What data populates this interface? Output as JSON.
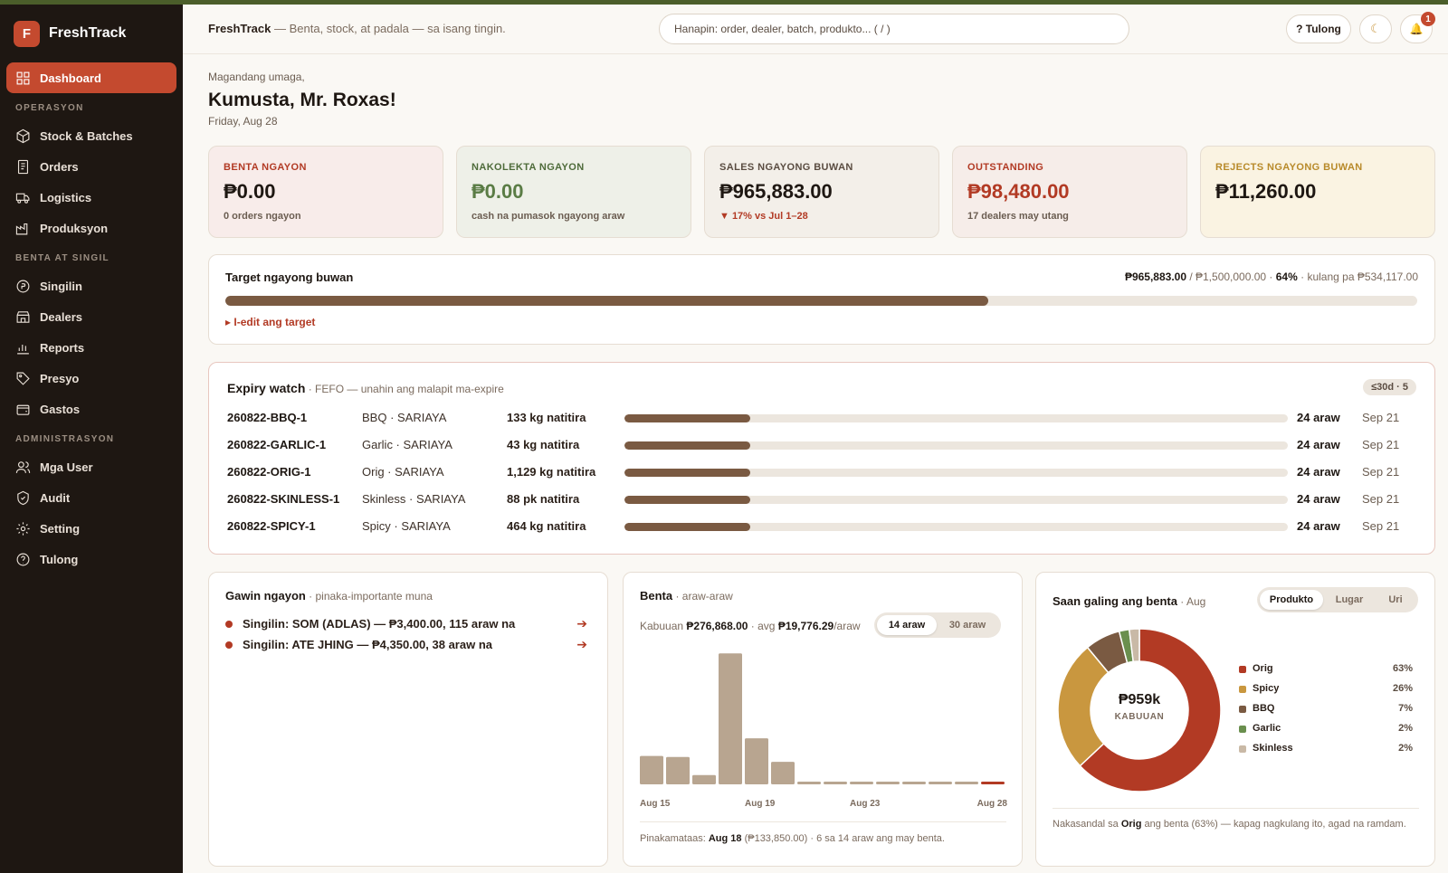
{
  "brand": {
    "logo_letter": "F",
    "name": "FreshTrack"
  },
  "sidebar": {
    "dashboard": "Dashboard",
    "sections": [
      {
        "title": "OPERASYON",
        "items": [
          "Stock & Batches",
          "Orders",
          "Logistics",
          "Produksyon"
        ]
      },
      {
        "title": "BENTA AT SINGIL",
        "items": [
          "Singilin",
          "Dealers",
          "Reports",
          "Presyo",
          "Gastos"
        ]
      },
      {
        "title": "ADMINISTRASYON",
        "items": [
          "Mga User",
          "Audit",
          "Setting",
          "Tulong"
        ]
      }
    ]
  },
  "topbar": {
    "app": "FreshTrack",
    "tagline": " — Benta, stock, at padala — sa isang tingin.",
    "search_placeholder": "Hanapin: order, dealer, batch, produkto...   ( / )",
    "help": "? Tulong",
    "theme_icon": "☾",
    "bell_icon": "🔔",
    "notif_count": "1"
  },
  "greeting": {
    "small": "Magandang umaga,",
    "name": "Kumusta, Mr. Roxas!",
    "date": "Friday, Aug 28"
  },
  "stats": [
    {
      "label": "BENTA NGAYON",
      "value": "₱0.00",
      "sub": "0 orders ngayon",
      "bg": "#f8ecea",
      "label_color": "#b23a24",
      "value_color": "#1e1712",
      "sub_color": "#6b5d51"
    },
    {
      "label": "NAKOLEKTA NGAYON",
      "value": "₱0.00",
      "sub": "cash na pumasok ngayong araw",
      "bg": "#eef0e8",
      "label_color": "#4e6b3a",
      "value_color": "#5a7c45",
      "sub_color": "#6b5d51"
    },
    {
      "label": "SALES NGAYONG BUWAN",
      "value": "₱965,883.00",
      "sub": "▼ 17% vs Jul 1–28",
      "bg": "#f3efe9",
      "label_color": "#5a4c41",
      "value_color": "#1e1712",
      "sub_color": "#b23a24"
    },
    {
      "label": "OUTSTANDING",
      "value": "₱98,480.00",
      "sub": "17 dealers may utang",
      "bg": "#f6ede9",
      "label_color": "#b23a24",
      "value_color": "#b23a24",
      "sub_color": "#6b5d51"
    },
    {
      "label": "REJECTS NGAYONG BUWAN",
      "value": "₱11,260.00",
      "sub": "",
      "bg": "#faf3e2",
      "label_color": "#b88a2a",
      "value_color": "#1e1712",
      "sub_color": "#6b5d51"
    }
  ],
  "target": {
    "title": "Target ngayong buwan",
    "current": "₱965,883.00",
    "goal": " / ₱1,500,000.00 · ",
    "pct": "64%",
    "remaining": " · kulang pa ₱534,117.00",
    "progress": 0.64,
    "edit": "▸ I-edit ang target"
  },
  "expiry": {
    "title": "Expiry watch",
    "subtitle": " · FEFO — unahin ang malapit ma-expire",
    "chip": "≤30d · 5",
    "rows": [
      {
        "batch": "260822-BBQ-1",
        "product": "BBQ · SARIAYA",
        "qty": "133 kg natitira",
        "fill": 0.19,
        "days": "24 araw",
        "date": "Sep 21"
      },
      {
        "batch": "260822-GARLIC-1",
        "product": "Garlic · SARIAYA",
        "qty": "43 kg natitira",
        "fill": 0.19,
        "days": "24 araw",
        "date": "Sep 21"
      },
      {
        "batch": "260822-ORIG-1",
        "product": "Orig · SARIAYA",
        "qty": "1,129 kg natitira",
        "fill": 0.19,
        "days": "24 araw",
        "date": "Sep 21"
      },
      {
        "batch": "260822-SKINLESS-1",
        "product": "Skinless · SARIAYA",
        "qty": "88 pk natitira",
        "fill": 0.19,
        "days": "24 araw",
        "date": "Sep 21"
      },
      {
        "batch": "260822-SPICY-1",
        "product": "Spicy · SARIAYA",
        "qty": "464 kg natitira",
        "fill": 0.19,
        "days": "24 araw",
        "date": "Sep 21"
      }
    ]
  },
  "todo": {
    "title": "Gawin ngayon",
    "subtitle": " · pinaka-importante muna",
    "items": [
      {
        "text": "Singilin: SOM (ADLAS) — ₱3,400.00, 115 araw na",
        "arrow": "➔"
      },
      {
        "text": "Singilin: ATE JHING — ₱4,350.00, 38 araw na",
        "arrow": "➔"
      }
    ]
  },
  "benta": {
    "title": "Benta",
    "subtitle": " · araw-araw",
    "total_prefix": "Kabuuan ",
    "total": "₱276,868.00",
    "avg_prefix": " · avg ",
    "avg": "₱19,776.29",
    "avg_suffix": "/araw",
    "range_options": [
      "14 araw",
      "30 araw"
    ],
    "footer_prefix": "Pinakamataas: ",
    "footer_day": "Aug 18",
    "footer_rest": " (₱133,850.00) · 6 sa 14 araw ang may benta."
  },
  "saan": {
    "title": "Saan galing ang benta",
    "subtitle": " · Aug",
    "tabs": [
      "Produkto",
      "Lugar",
      "Uri"
    ],
    "center_value": "₱959k",
    "center_label": "KABUUAN",
    "footer_pre": "Nakasandal sa ",
    "footer_bold": "Orig",
    "footer_post": " ang benta (63%) — kapag nagkulang ito, agad na ramdam."
  },
  "chart_data": [
    {
      "type": "bar",
      "title": "Benta · araw-araw",
      "categories": [
        "Aug 15",
        "Aug 16",
        "Aug 17",
        "Aug 18",
        "Aug 19",
        "Aug 20",
        "Aug 21",
        "Aug 22",
        "Aug 23",
        "Aug 24",
        "Aug 25",
        "Aug 26",
        "Aug 27",
        "Aug 28"
      ],
      "tick_labels": [
        "Aug 15",
        "Aug 19",
        "Aug 23",
        "Aug 28"
      ],
      "values": [
        29000,
        28000,
        9500,
        133850,
        47000,
        23000,
        0,
        0,
        0,
        0,
        0,
        0,
        0,
        0
      ],
      "bar_color": "#b8a590",
      "highlight_color": "#b23a24",
      "ylim": [
        0,
        135000
      ]
    },
    {
      "type": "pie",
      "title": "Saan galing ang benta · Aug",
      "labels": [
        "Orig",
        "Spicy",
        "BBQ",
        "Garlic",
        "Skinless"
      ],
      "values": [
        63,
        26,
        7,
        2,
        2
      ],
      "value_labels": [
        "63%",
        "26%",
        "7%",
        "2%",
        "2%"
      ],
      "colors": [
        "#b23a24",
        "#c9973f",
        "#7a5a42",
        "#6a8f4e",
        "#c9b9a6"
      ]
    }
  ]
}
